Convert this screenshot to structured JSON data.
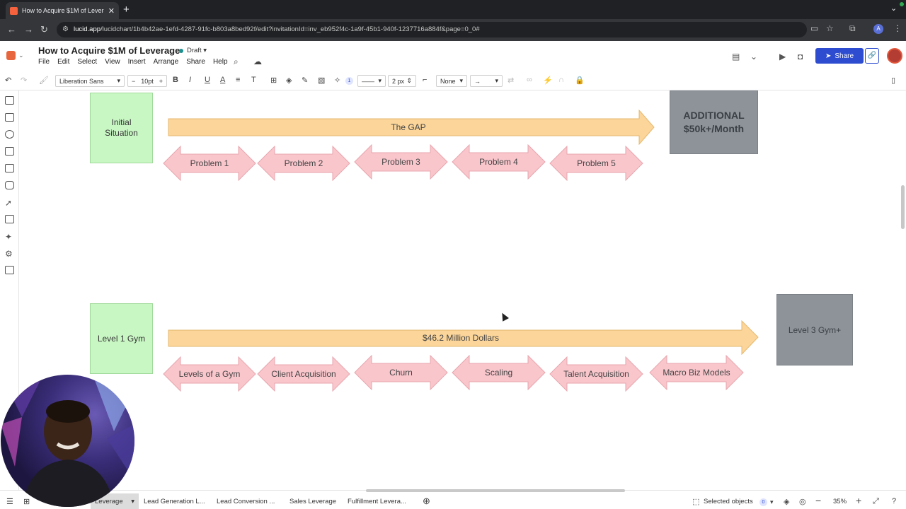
{
  "browser": {
    "tab_title": "How to Acquire $1M of Leverage",
    "url_host": "lucid.app",
    "url_path": "/lucidchart/1b4b42ae-1efd-4287-91fc-b803a8bed92f/edit?invitationId=inv_eb952f4c-1a9f-45b1-940f-1237716a884f&page=0_0#",
    "profile_letter": "A"
  },
  "header": {
    "doc_title": "How to Acquire $1M of Leverage",
    "status": "Draft",
    "menu": [
      "File",
      "Edit",
      "Select",
      "View",
      "Insert",
      "Arrange",
      "Share",
      "Help"
    ],
    "share_label": "Share"
  },
  "toolbar": {
    "font": "Liberation Sans",
    "font_size": "10pt",
    "badge": "1",
    "line_width": "2 px",
    "endpoint": "None"
  },
  "diagram_top": {
    "start_box": "Initial Situation",
    "gap_arrow": "The GAP",
    "end_box": "ADDITIONAL $50k+/Month",
    "problems": [
      "Problem 1",
      "Problem 2",
      "Problem 3",
      "Problem 4",
      "Problem 5"
    ]
  },
  "diagram_bottom": {
    "start_box": "Level 1 Gym",
    "gap_arrow": "$46.2 Million Dollars",
    "end_box": "Level 3 Gym+",
    "problems": [
      "Levels of a Gym",
      "Client Acquisition",
      "Churn",
      "Scaling",
      "Talent Acquisition",
      "Macro Biz Models"
    ]
  },
  "footer": {
    "page_tabs": [
      "Leverage",
      "Lead Generation L...",
      "Lead Conversion ...",
      "Sales Leverage",
      "Fulfillment Levera..."
    ],
    "selected_objects_label": "Selected objects",
    "selected_count": "0",
    "zoom": "35%"
  },
  "colors": {
    "green_box": "#c9f7c4",
    "gray_box": "#8d9399",
    "gap_arrow": "#fbd59a",
    "problem_arrow": "#f9c6cc",
    "share_button": "#2d4ccf"
  }
}
